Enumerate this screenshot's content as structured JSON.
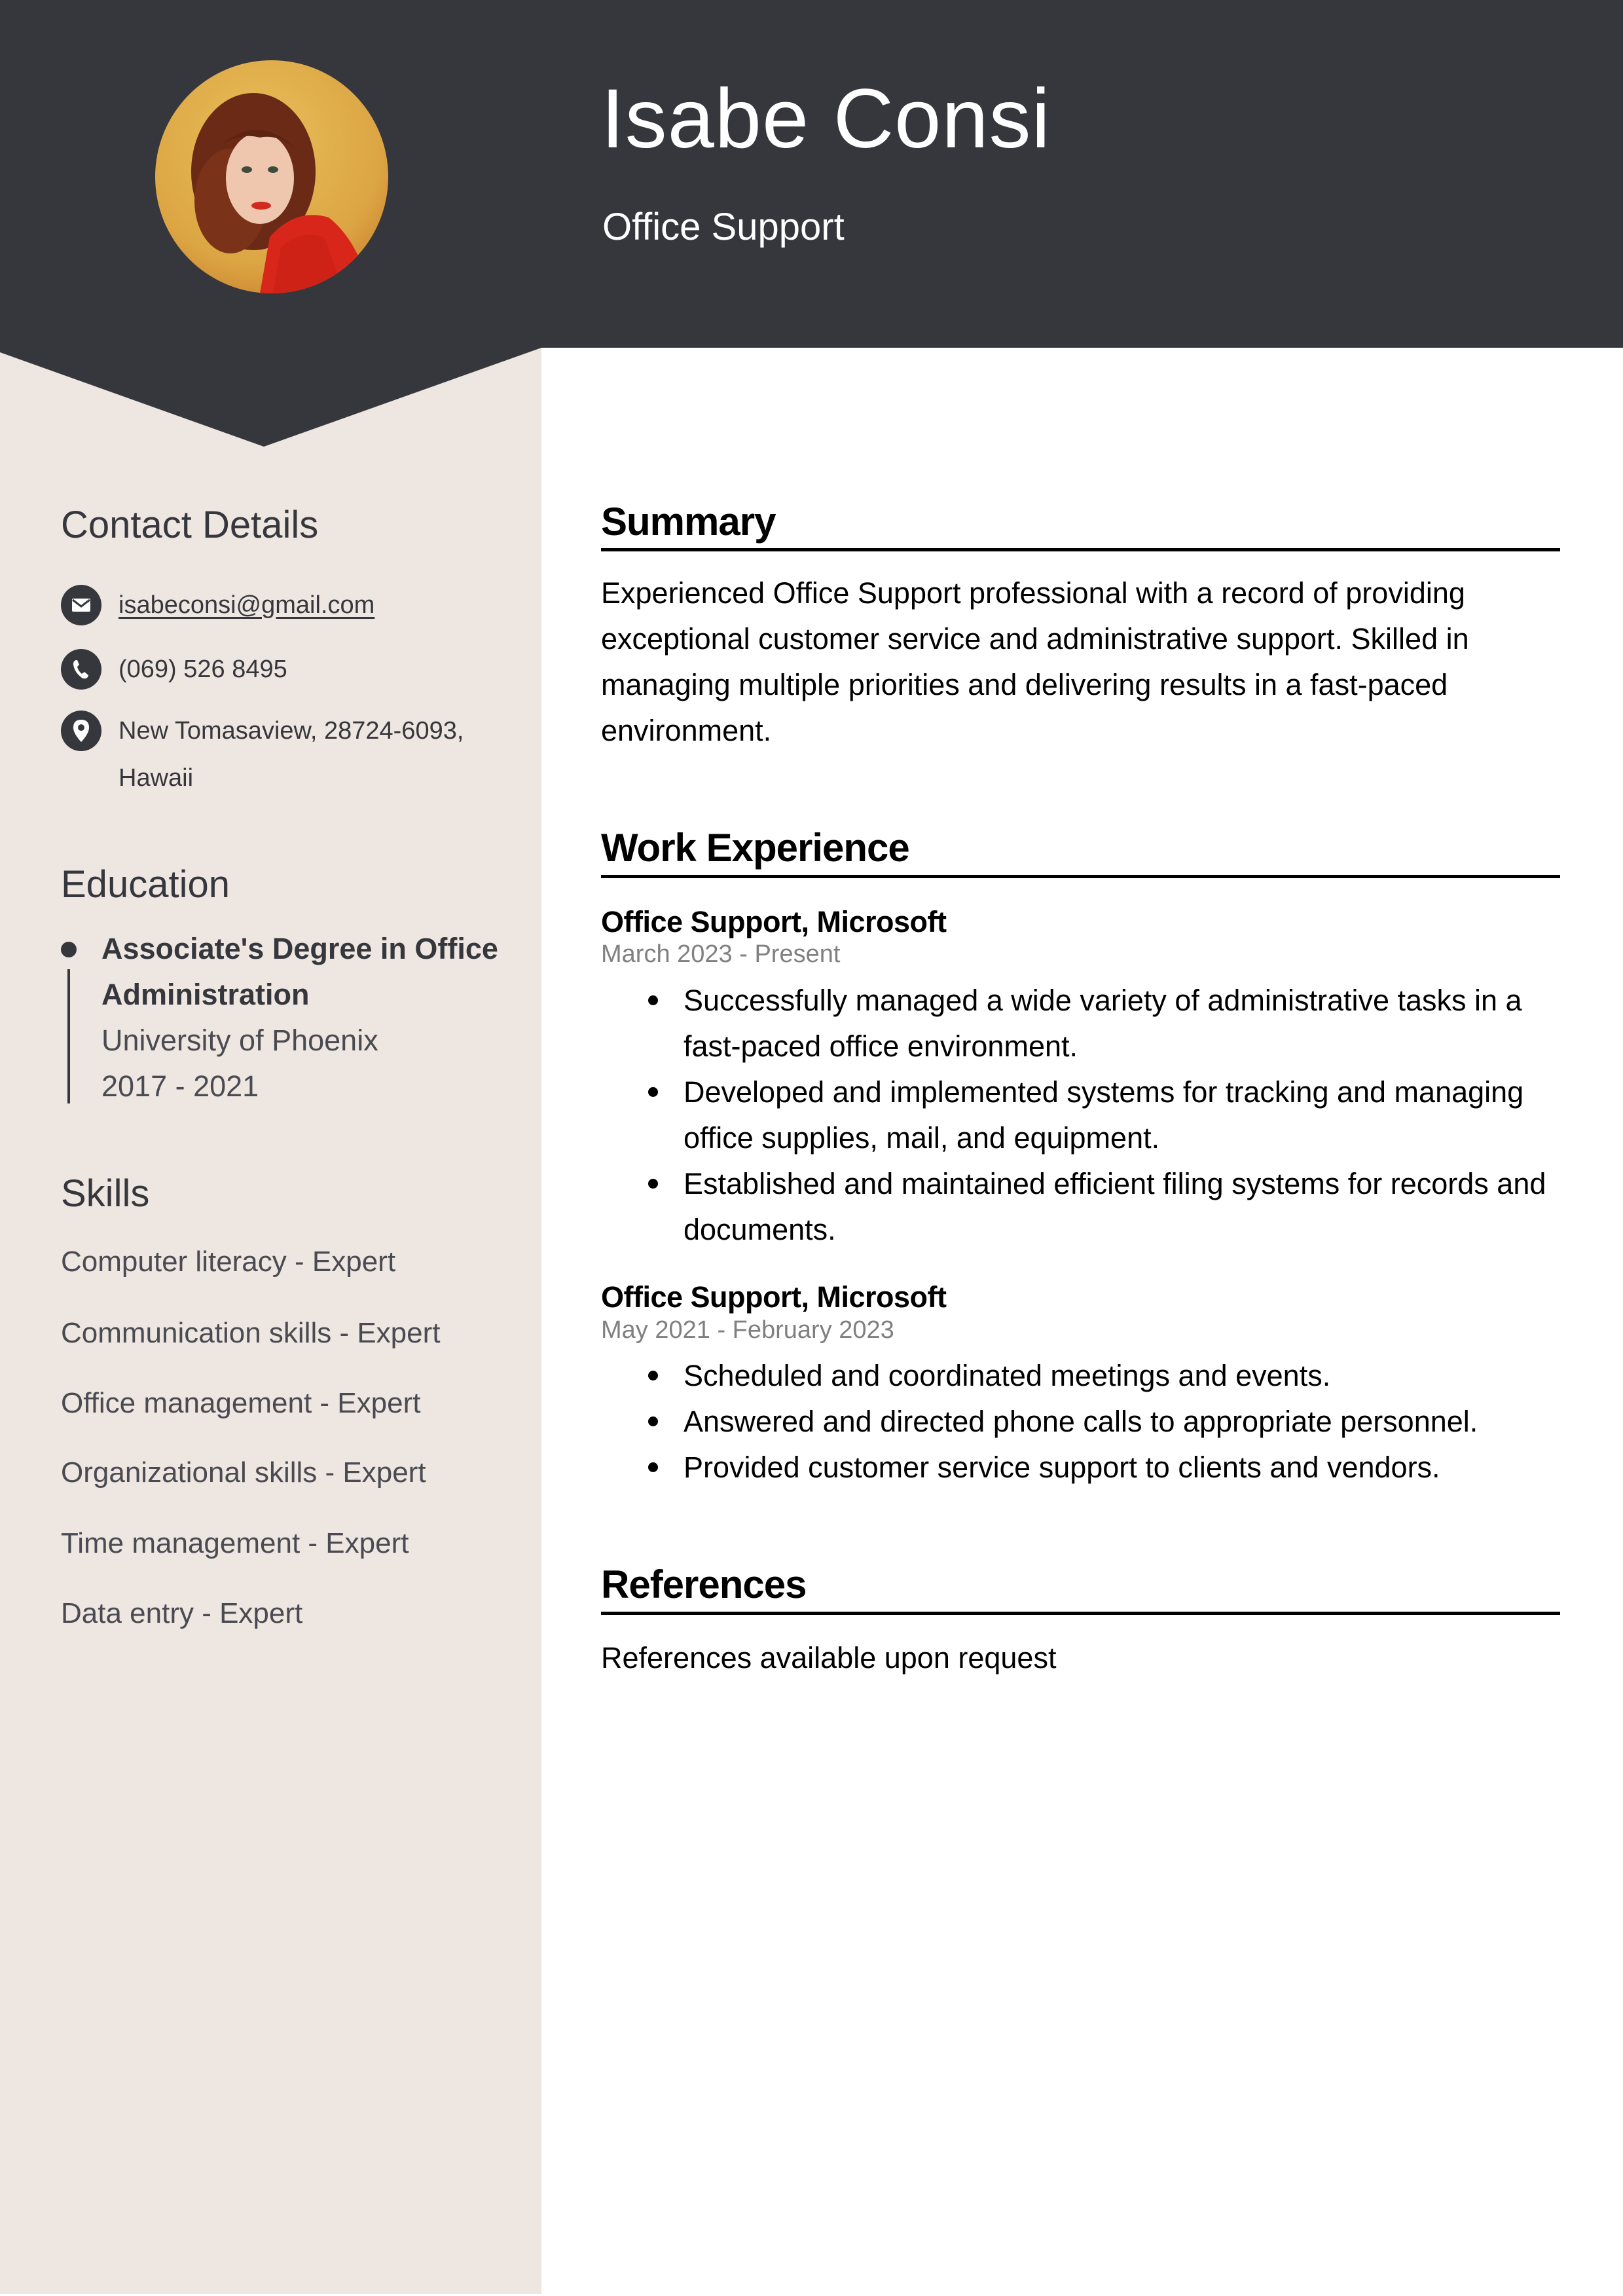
{
  "header": {
    "name": "Isabe Consi",
    "title": "Office Support",
    "photo_alt": "profile-photo"
  },
  "colors": {
    "header_bg": "#36373d",
    "sidebar_bg": "#ede6e1",
    "date_gray": "#808080"
  },
  "sidebar": {
    "contact": {
      "heading": "Contact Details",
      "items": [
        {
          "icon": "envelope-icon",
          "text": "isabeconsi@gmail.com"
        },
        {
          "icon": "phone-icon",
          "text": "(069) 526 8495"
        },
        {
          "icon": "location-pin-icon",
          "text": "New Tomasaview, 28724-6093, Hawaii"
        }
      ]
    },
    "education": {
      "heading": "Education",
      "items": [
        {
          "degree": "Associate's Degree in Office Administration",
          "school": "University of Phoenix",
          "years": "2017 - 2021"
        }
      ]
    },
    "skills": {
      "heading": "Skills",
      "items": [
        "Computer literacy - Expert",
        "Communication skills - Expert",
        "Office management - Expert",
        "Organizational skills - Expert",
        "Time management - Expert",
        "Data entry - Expert"
      ]
    }
  },
  "main": {
    "summary": {
      "heading": "Summary",
      "text": "Experienced Office Support professional with a record of providing exceptional customer service and administrative support. Skilled in managing multiple priorities and delivering results in a fast-paced environment."
    },
    "experience": {
      "heading": "Work Experience",
      "jobs": [
        {
          "title": "Office Support, Microsoft",
          "dates": "March 2023 - Present",
          "bullets": [
            "Successfully managed a wide variety of administrative tasks in a fast-paced office environment.",
            "Developed and implemented systems for tracking and managing office supplies, mail, and equipment.",
            "Established and maintained efficient filing systems for records and documents."
          ]
        },
        {
          "title": "Office Support, Microsoft",
          "dates": "May 2021 - February 2023",
          "bullets": [
            "Scheduled and coordinated meetings and events.",
            "Answered and directed phone calls to appropriate personnel.",
            "Provided customer service support to clients and vendors."
          ]
        }
      ]
    },
    "references": {
      "heading": "References",
      "text": "References available upon request"
    }
  }
}
